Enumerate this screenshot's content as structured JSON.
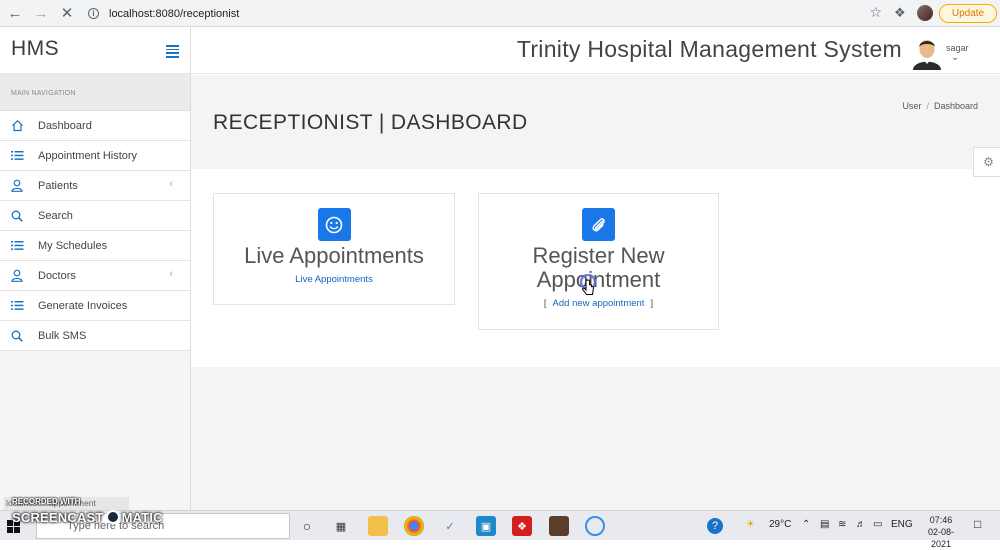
{
  "browser": {
    "url": "localhost:8080/receptionist",
    "update_label": "Update"
  },
  "sidebar": {
    "brand": "HMS",
    "heading": "MAIN NAVIGATION",
    "items": [
      {
        "label": "Dashboard",
        "icon": "home-icon"
      },
      {
        "label": "Appointment History",
        "icon": "list-icon"
      },
      {
        "label": "Patients",
        "icon": "user-icon"
      },
      {
        "label": "Search",
        "icon": "search-icon"
      },
      {
        "label": "My Schedules",
        "icon": "list-icon"
      },
      {
        "label": "Doctors",
        "icon": "user-icon"
      },
      {
        "label": "Generate Invoices",
        "icon": "list-icon"
      },
      {
        "label": "Bulk SMS",
        "icon": "search-icon"
      }
    ]
  },
  "header": {
    "title": "Trinity Hospital Management System",
    "user": "sagar"
  },
  "page": {
    "title": "RECEPTIONIST | DASHBOARD",
    "breadcrumb": [
      "User",
      "Dashboard"
    ]
  },
  "cards": [
    {
      "title": "Live Appointments",
      "link": "Live Appointments"
    },
    {
      "title_line1": "Register New",
      "title_line2": "Appointment",
      "link": "Add new appointment",
      "bracket_open": "[",
      "bracket_close": "]"
    }
  ],
  "overlay": {
    "status_text": "localhost:...appointment",
    "recorder_label": "RECORDED WITH",
    "recorder_brand_a": "SCREENCAST",
    "recorder_brand_b": "MATIC"
  },
  "taskbar": {
    "search_placeholder": "Type here to search",
    "weather": "29°C",
    "lang": "ENG",
    "time": "07:46",
    "date": "02-08-2021"
  },
  "colors": {
    "accent": "#1977e8",
    "link": "#1565c0",
    "update": "#e37400"
  }
}
